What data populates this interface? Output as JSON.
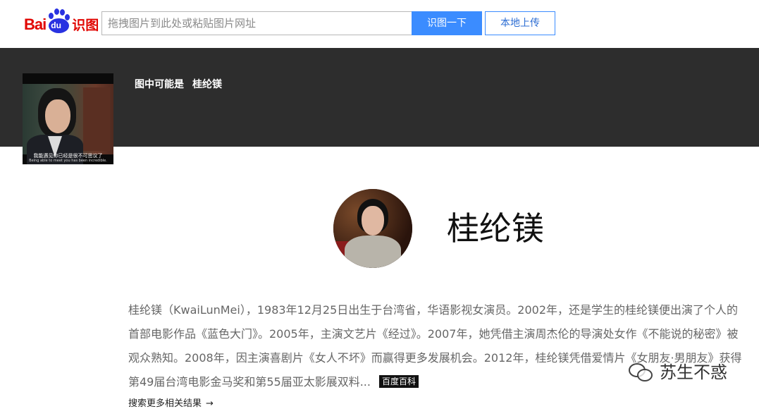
{
  "logo": {
    "bai": "Bai",
    "du": "du",
    "shitu": "识图"
  },
  "search": {
    "placeholder": "拖拽图片到此处或粘贴图片网址"
  },
  "buttons": {
    "recognize": "识图一下",
    "upload": "本地上传"
  },
  "result": {
    "maybe_label": "图中可能是",
    "maybe_name": "桂纶镁",
    "thumb_subtitle_cn": "我能遇见你已经是很不可思议了",
    "thumb_subtitle_en": "Being able to meet you has been incredible.",
    "person_name": "桂纶镁",
    "description": "桂纶镁（KwaiLunMei），1983年12月25日出生于台湾省，华语影视女演员。2002年，还是学生的桂纶镁便出演了个人的首部电影作品《蓝色大门》。2005年，主演文艺片《经过》。2007年，她凭借主演周杰伦的导演处女作《不能说的秘密》被观众熟知。2008年，因主演喜剧片《女人不坏》而赢得更多发展机会。2012年，桂纶镁凭借爱情片《女朋友·男朋友》获得第49届台湾电影金马奖和第55届亚太影展双料...",
    "source_badge": "百度百科",
    "more_link": "搜索更多相关结果",
    "more_arrow": "→"
  },
  "watermark": {
    "text": "苏生不惑"
  },
  "colors": {
    "brand_red": "#e10602",
    "brand_blue": "#2932e1",
    "button_blue": "#3b8cff",
    "banner": "#2d2d2d"
  },
  "icons": {
    "logo_paw": "baidu-paw-icon",
    "arrow": "arrow-right-icon",
    "wechat": "wechat-icon"
  }
}
